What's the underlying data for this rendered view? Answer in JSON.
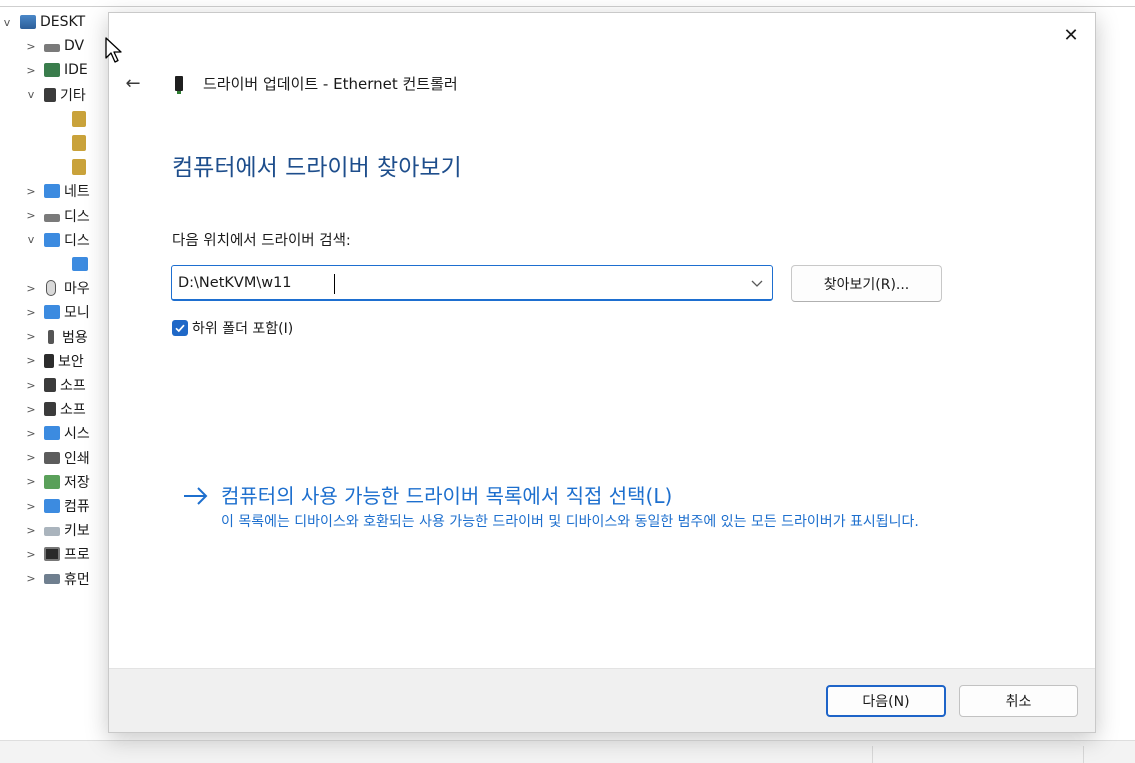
{
  "background_window": {
    "tree": [
      {
        "chevron": "v",
        "label": "DESKT",
        "icon": "computer-icon"
      },
      {
        "chevron": ">",
        "label": "DV",
        "icon": "disk-drive-icon"
      },
      {
        "chevron": ">",
        "label": "IDE",
        "icon": "ide-controller-icon"
      },
      {
        "chevron": "v",
        "label": "기타",
        "icon": "other-devices-icon"
      },
      {
        "chevron": "",
        "label": "",
        "icon": "unknown-device-warning-icon"
      },
      {
        "chevron": "",
        "label": "",
        "icon": "unknown-device-warning-icon"
      },
      {
        "chevron": "",
        "label": "",
        "icon": "unknown-device-warning-icon"
      },
      {
        "chevron": ">",
        "label": "네트",
        "icon": "network-icon"
      },
      {
        "chevron": ">",
        "label": "디스",
        "icon": "disk-icon"
      },
      {
        "chevron": "v",
        "label": "디스",
        "icon": "display-adapter-icon"
      },
      {
        "chevron": "",
        "label": "",
        "icon": "display-adapter-child-icon"
      },
      {
        "chevron": ">",
        "label": "마우",
        "icon": "mouse-icon"
      },
      {
        "chevron": ">",
        "label": "모니",
        "icon": "monitor-icon"
      },
      {
        "chevron": ">",
        "label": "범용",
        "icon": "usb-icon"
      },
      {
        "chevron": ">",
        "label": "보안",
        "icon": "security-icon"
      },
      {
        "chevron": ">",
        "label": "소프",
        "icon": "software-component-icon"
      },
      {
        "chevron": ">",
        "label": "소프",
        "icon": "software-device-icon"
      },
      {
        "chevron": ">",
        "label": "시스",
        "icon": "system-device-icon"
      },
      {
        "chevron": ">",
        "label": "인쇄",
        "icon": "print-queue-icon"
      },
      {
        "chevron": ">",
        "label": "저장",
        "icon": "storage-controller-icon"
      },
      {
        "chevron": ">",
        "label": "컴퓨",
        "icon": "computer-monitor-icon"
      },
      {
        "chevron": ">",
        "label": "키보",
        "icon": "keyboard-icon"
      },
      {
        "chevron": ">",
        "label": "프로",
        "icon": "processor-icon"
      },
      {
        "chevron": ">",
        "label": "휴먼",
        "icon": "hid-icon"
      }
    ]
  },
  "dialog": {
    "close_glyph": "✕",
    "back_glyph": "←",
    "title": "드라이버 업데이트 - Ethernet 컨트롤러",
    "heading": "컴퓨터에서 드라이버 찾아보기",
    "search_label": "다음 위치에서 드라이버 검색:",
    "path_value": "D:\\NetKVM\\w11",
    "browse_label": "찾아보기(R)...",
    "include_subfolders": {
      "label": "하위 폴더 포함(I)",
      "checked": true
    },
    "pick_link": {
      "title": "컴퓨터의 사용 가능한 드라이버 목록에서 직접 선택(L)",
      "description": "이 목록에는 디바이스와 호환되는 사용 가능한 드라이버 및 디바이스와 동일한 범주에 있는 모든 드라이버가 표시됩니다."
    },
    "next_label": "다음(N)",
    "cancel_label": "취소"
  }
}
